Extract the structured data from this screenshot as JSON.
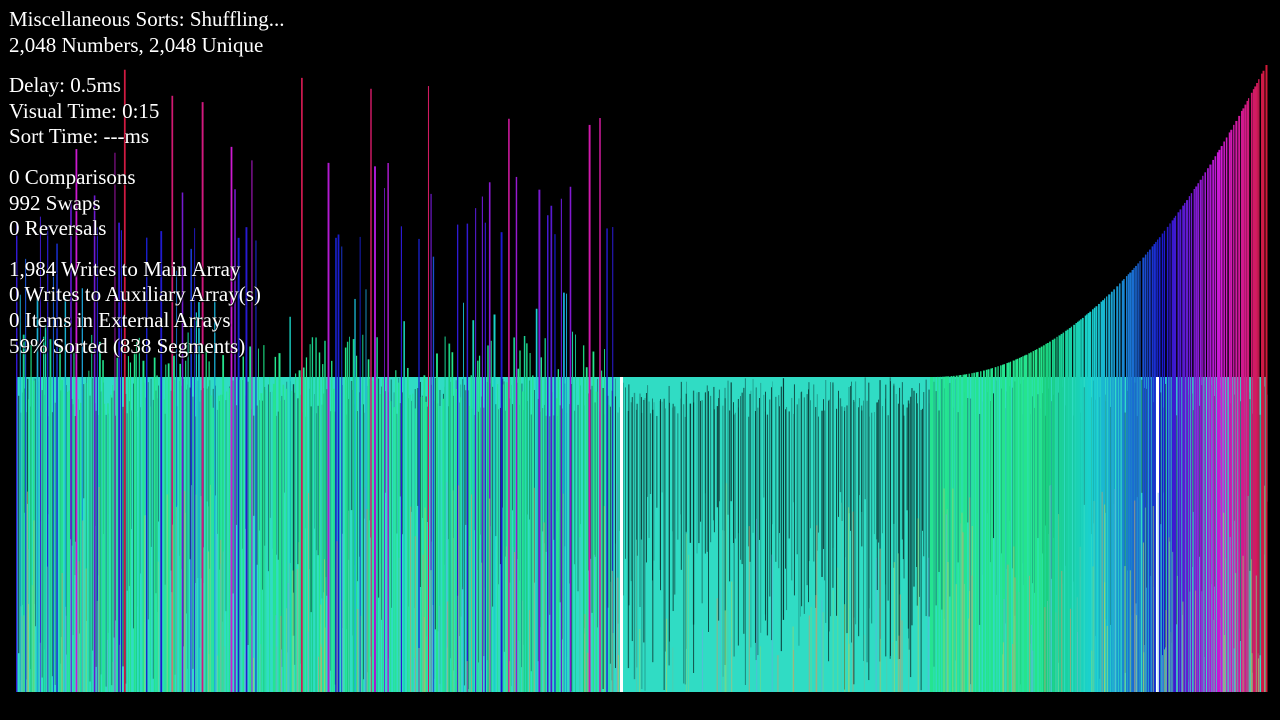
{
  "header": {
    "title": "Miscellaneous Sorts: Shuffling...",
    "numbers": "2,048 Numbers, 2,048 Unique"
  },
  "timing": {
    "delay": "Delay: 0.5ms",
    "visual_time": "Visual Time: 0:15",
    "sort_time": "Sort Time: ---ms"
  },
  "counters": {
    "comparisons": "0 Comparisons",
    "swaps": "992 Swaps",
    "reversals": "0 Reversals"
  },
  "writes": {
    "main": "1,984 Writes to Main Array",
    "auxiliary": "0 Writes to Auxiliary Array(s)",
    "external": "0 Items in External Arrays",
    "sorted": "59% Sorted (838 Segments)"
  },
  "visualization": {
    "element_count": 2048,
    "sorted_percent": 59,
    "background": "#000000",
    "plateau_color": "#30dcc4",
    "hue_range": [
      "teal",
      "blue",
      "purple",
      "magenta",
      "red"
    ]
  }
}
